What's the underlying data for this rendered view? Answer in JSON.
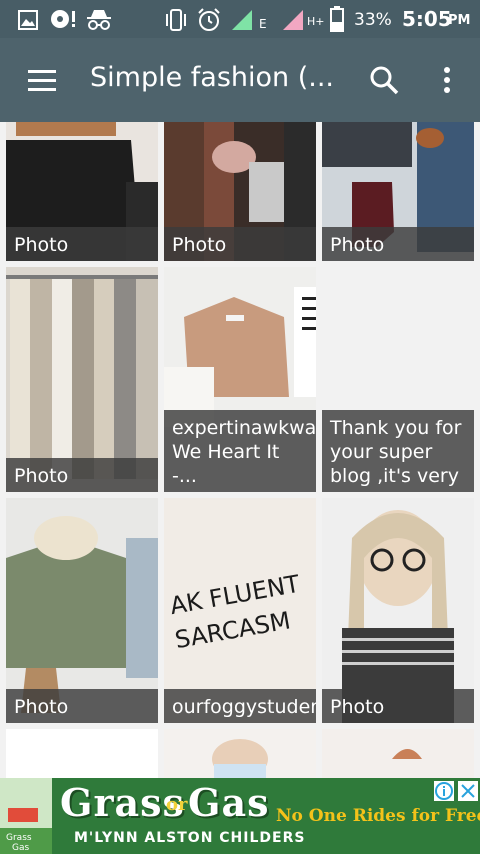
{
  "status_bar": {
    "battery_percent": "33%",
    "time": "5:05",
    "ampm": "PM",
    "network_e": "E",
    "network_h": "H+",
    "icons": [
      "gallery-icon",
      "music-alert-icon",
      "incognito-icon",
      "vibrate-icon",
      "alarm-icon",
      "signal-icon",
      "signal-roaming-icon",
      "battery-icon"
    ]
  },
  "app_bar": {
    "title": "Simple fashion (...",
    "menu_icon": "hamburger-menu-icon",
    "search_icon": "search-icon",
    "more_icon": "more-vert-icon"
  },
  "tiles": [
    {
      "caption": "Photo",
      "image": "black-skirt-outfit"
    },
    {
      "caption": "Photo",
      "image": "scarves-boots-outfit"
    },
    {
      "caption": "Photo",
      "image": "burgundy-boots-jeans"
    },
    {
      "caption": "Photo",
      "image": "knit-sweaters-rack"
    },
    {
      "caption": "expertinawkward: We Heart It -...",
      "image": "folded-sweater"
    },
    {
      "caption": "Thank you for your super blog ,it's very",
      "image": "blank"
    },
    {
      "caption": "Photo",
      "image": "green-sweater-scarf"
    },
    {
      "caption": "ourfoggystudenteagle:",
      "image": "fluent-sarcasm-tee"
    },
    {
      "caption": "Photo",
      "image": "girl-glasses-braids"
    }
  ],
  "ad": {
    "title_left": "Grass",
    "title_or": "or",
    "title_right": "Gas",
    "author": "M'LYNN ALSTON CHILDERS",
    "tagline": "No One Rides for Free",
    "logo_text": "Grass Gas",
    "info_icon": "info-icon",
    "close_icon": "close-icon"
  },
  "colors": {
    "status_bar": "#485d66",
    "app_bar": "#4e636c",
    "caption_bg": "#3c3c3c",
    "ad_bg": "#2f7a3a"
  }
}
